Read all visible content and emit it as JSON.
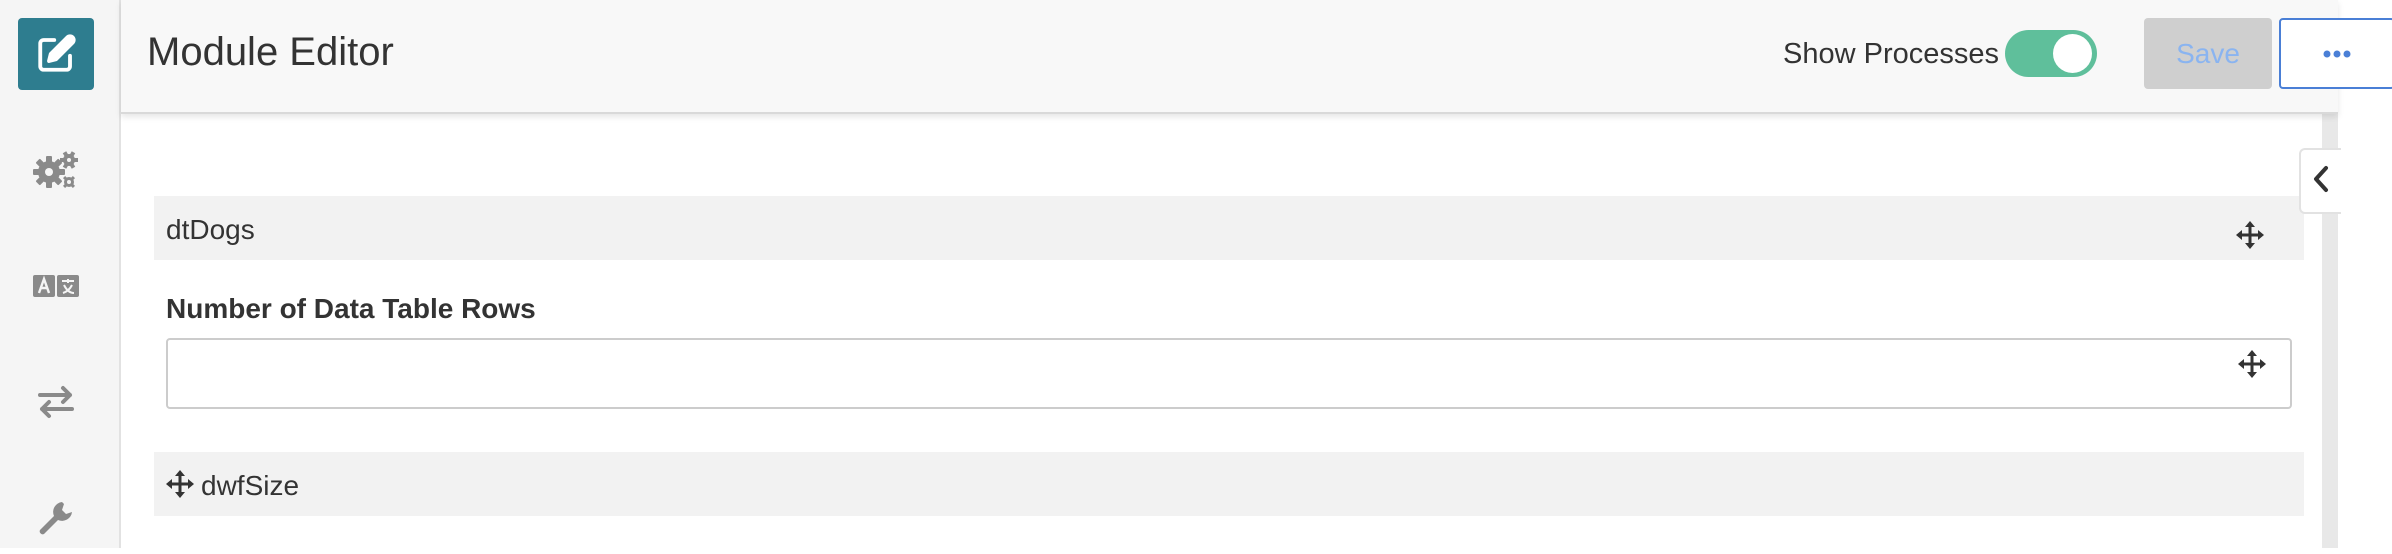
{
  "sidebar": {
    "items": [
      {
        "icon": "edit-icon",
        "active": true
      },
      {
        "icon": "gears-icon",
        "active": false
      },
      {
        "icon": "translate-icon",
        "active": false
      },
      {
        "icon": "swap-arrows-icon",
        "active": false
      },
      {
        "icon": "wrench-icon",
        "active": false
      }
    ]
  },
  "header": {
    "title": "Module Editor",
    "show_processes_label": "Show Processes",
    "show_processes_on": true,
    "save_label": "Save",
    "more_icon": "ellipsis-icon"
  },
  "canvas": {
    "data_table_name": "dtDogs",
    "rows_field_label": "Number of Data Table Rows",
    "rows_field_value": "",
    "size_field_name": "dwfSize"
  },
  "colors": {
    "accent": "#2e7d8f",
    "toggle_on": "#5fbf9b",
    "save_disabled_bg": "#cfcfcf",
    "save_text": "#8ab4f0",
    "more_border": "#4a7fd6"
  }
}
